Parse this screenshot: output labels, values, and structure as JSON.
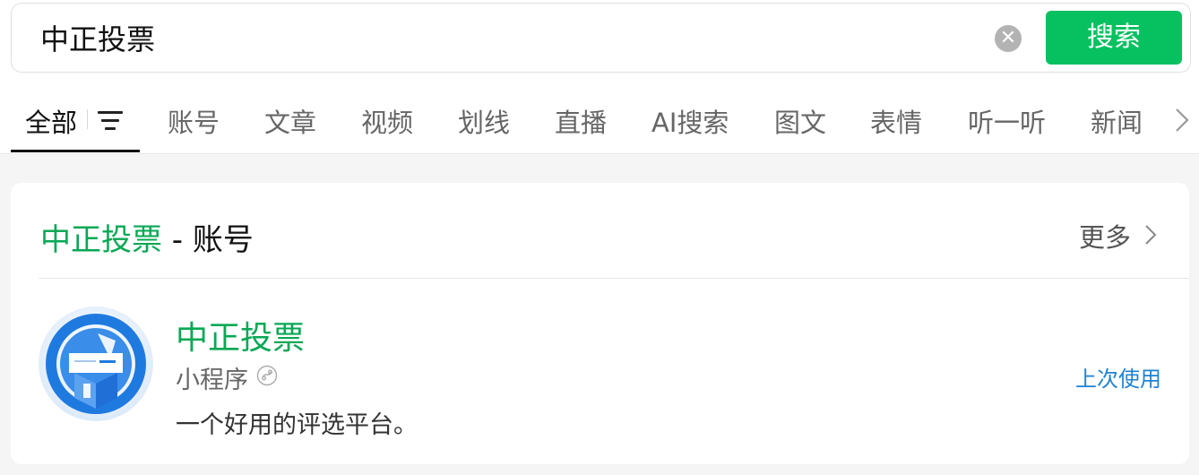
{
  "search": {
    "query": "中正投票",
    "clear_icon": "close-circle-icon",
    "button_label": "搜索"
  },
  "tabs": [
    {
      "label": "全部",
      "active": true
    },
    {
      "label": "账号"
    },
    {
      "label": "文章"
    },
    {
      "label": "视频"
    },
    {
      "label": "划线"
    },
    {
      "label": "直播"
    },
    {
      "label": "AI搜索"
    },
    {
      "label": "图文"
    },
    {
      "label": "表情"
    },
    {
      "label": "听一听"
    },
    {
      "label": "新闻"
    }
  ],
  "tab_icons": {
    "filter": "filter-icon",
    "more": "chevron-right-icon"
  },
  "section": {
    "title_highlight": "中正投票",
    "title_rest": " - 账号",
    "more_label": "更多"
  },
  "result": {
    "name": "中正投票",
    "type_label": "小程序",
    "type_icon": "mini-program-icon",
    "description": "一个好用的评选平台。",
    "recent_label": "上次使用"
  },
  "colors": {
    "accent": "#07c160",
    "highlight_text": "#07a854",
    "link": "#1e82d2"
  }
}
